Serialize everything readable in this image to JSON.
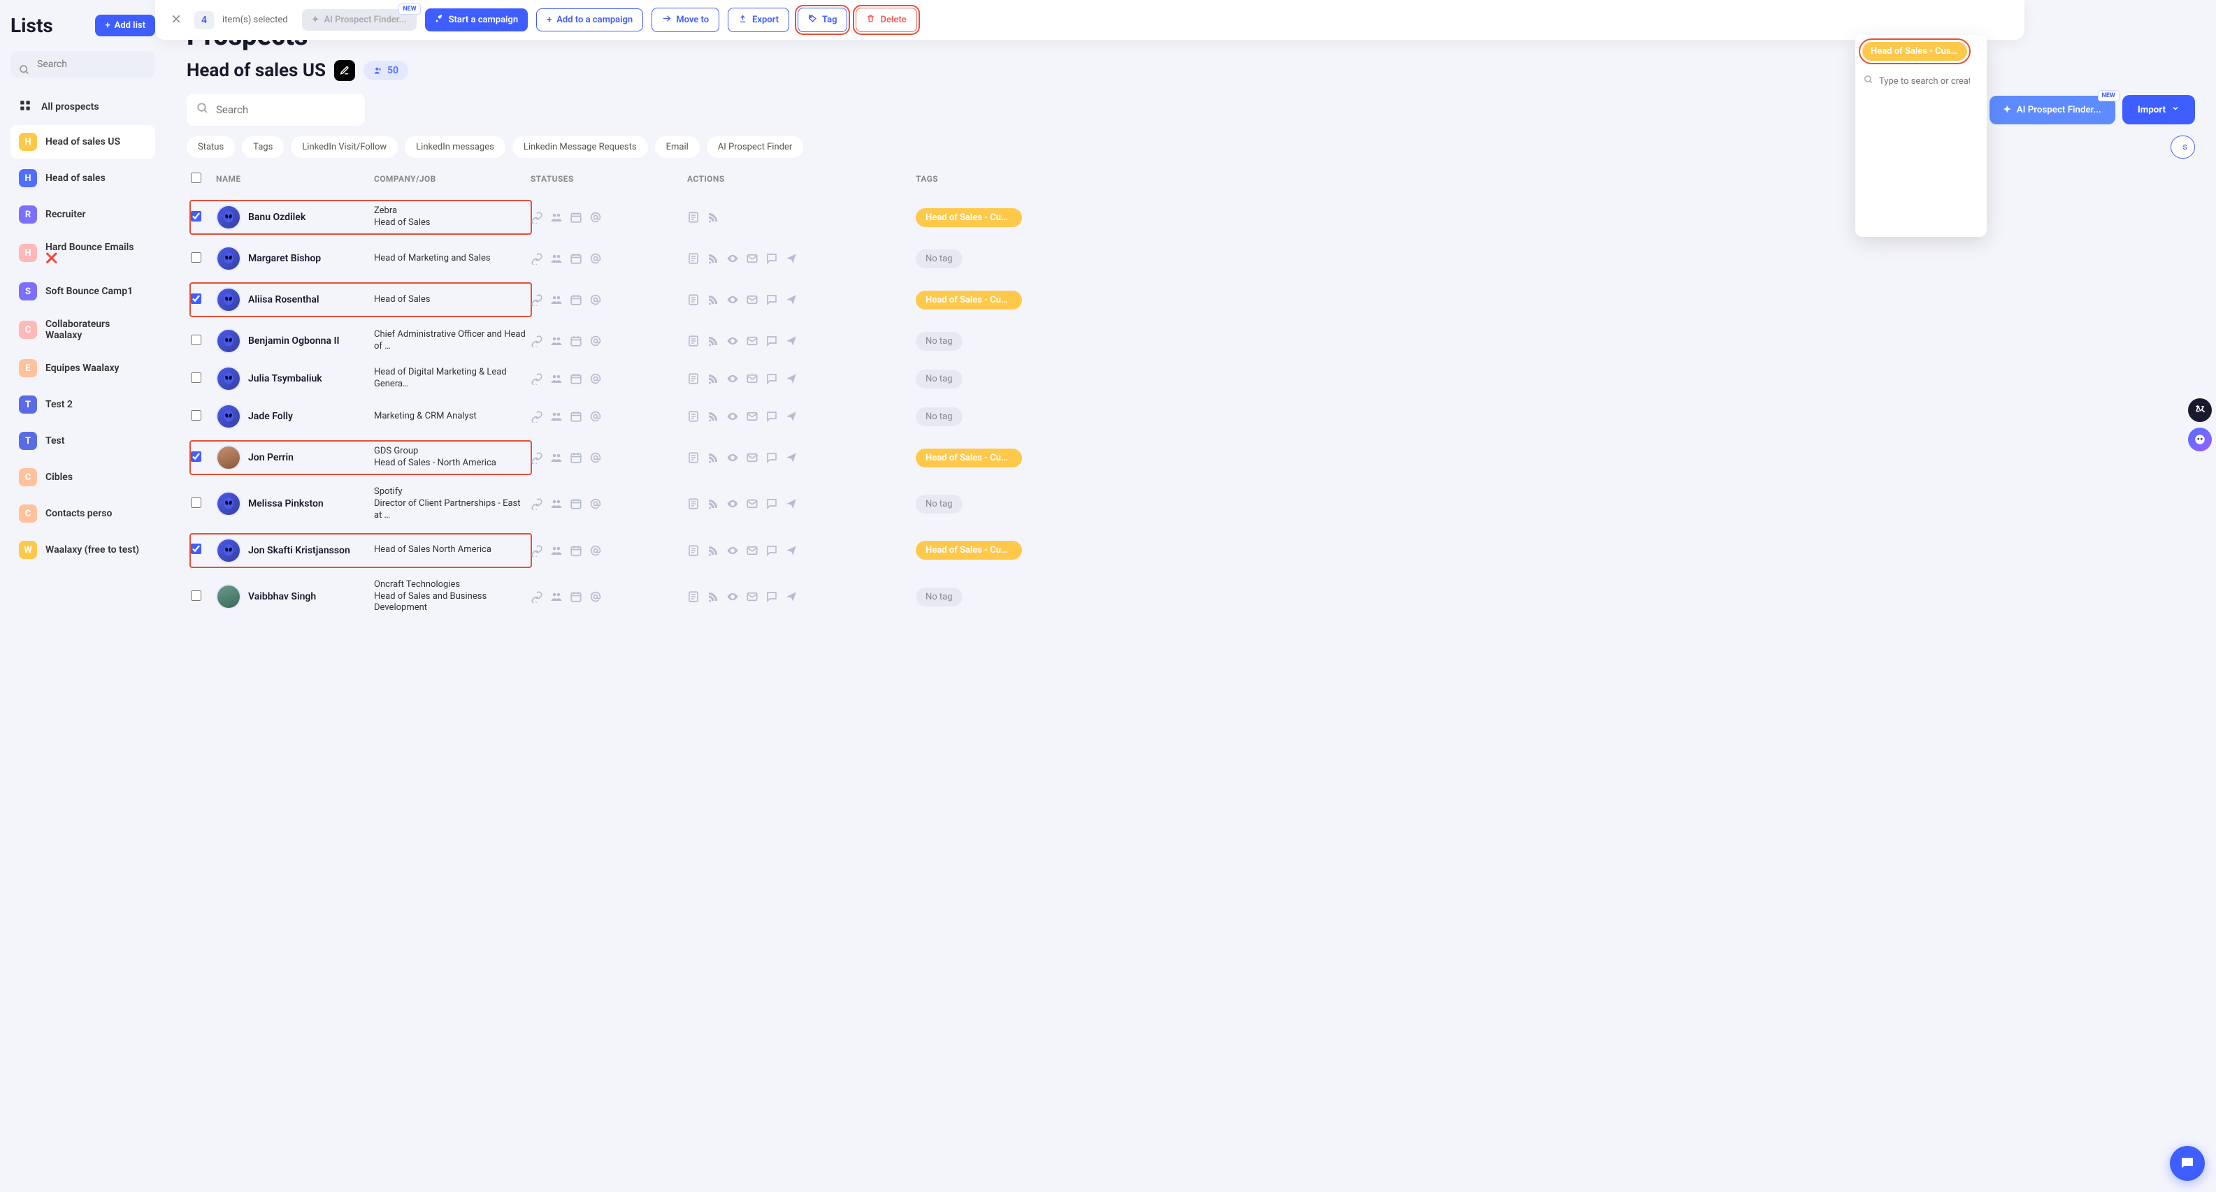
{
  "sidebar": {
    "title": "Lists",
    "add_list": "Add list",
    "search_placeholder": "Search",
    "all_prospects": "All prospects",
    "items": [
      {
        "letter": "H",
        "label": "Head of sales US",
        "cls": "ic-yellow",
        "active": true
      },
      {
        "letter": "H",
        "label": "Head of sales",
        "cls": "ic-blue"
      },
      {
        "letter": "R",
        "label": "Recruiter",
        "cls": "ic-purple"
      },
      {
        "letter": "H",
        "label": "Hard Bounce Emails ❌",
        "cls": "ic-pink"
      },
      {
        "letter": "S",
        "label": "Soft Bounce Camp1",
        "cls": "ic-purple"
      },
      {
        "letter": "C",
        "label": "Collaborateurs Waalaxy",
        "cls": "ic-pink"
      },
      {
        "letter": "E",
        "label": "Equipes Waalaxy",
        "cls": "ic-peach"
      },
      {
        "letter": "T",
        "label": "Test 2",
        "cls": "ic-teal"
      },
      {
        "letter": "T",
        "label": "Test",
        "cls": "ic-teal"
      },
      {
        "letter": "C",
        "label": "Cibles",
        "cls": "ic-peach"
      },
      {
        "letter": "C",
        "label": "Contacts perso",
        "cls": "ic-peach"
      },
      {
        "letter": "W",
        "label": "Waalaxy (free to test)",
        "cls": "ic-yellow"
      }
    ]
  },
  "topbar": {
    "count": "4",
    "selected_text": "item(s) selected",
    "ai": "AI Prospect Finder...",
    "new": "NEW",
    "start": "Start a campaign",
    "add": "Add to a campaign",
    "move": "Move to",
    "export": "Export",
    "tag": "Tag",
    "delete": "Delete"
  },
  "tag_dropdown": {
    "pill": "Head of Sales - Cust…",
    "placeholder": "Type to search or create a"
  },
  "main": {
    "title": "Prospects",
    "list_name": "Head of sales US",
    "count": "50",
    "search_placeholder": "Search",
    "ai_finder": "AI Prospect Finder...",
    "new": "NEW",
    "import": "Import",
    "filters": [
      "Status",
      "Tags",
      "LinkedIn Visit/Follow",
      "LinkedIn messages",
      "Linkedin Message Requests",
      "Email",
      "AI Prospect Finder"
    ],
    "partial_filter": "s"
  },
  "columns": {
    "name": "NAME",
    "company": "COMPANY/JOB",
    "statuses": "STATUSES",
    "actions": "ACTIONS",
    "tags": "TAGS"
  },
  "rows": [
    {
      "checked": true,
      "hl": true,
      "name": "Banu Ozdilek",
      "company": "Zebra",
      "job": "Head of Sales",
      "tag": "Head of Sales - Cust…",
      "actions_short": true
    },
    {
      "checked": false,
      "hl": false,
      "name": "Margaret Bishop",
      "company": "",
      "job": "Head of Marketing and Sales",
      "no_tag": true
    },
    {
      "checked": true,
      "hl": true,
      "name": "Aliisa Rosenthal",
      "company": "",
      "job": "Head of Sales",
      "tag": "Head of Sales - Cust…"
    },
    {
      "checked": false,
      "hl": false,
      "name": "Benjamin Ogbonna II",
      "company": "",
      "job": "Chief Administrative Officer and Head of …",
      "no_tag": true
    },
    {
      "checked": false,
      "hl": false,
      "name": "Julia Tsymbaliuk",
      "company": "",
      "job": "Head of Digital Marketing & Lead Genera…",
      "no_tag": true
    },
    {
      "checked": false,
      "hl": false,
      "name": "Jade Folly",
      "company": "",
      "job": "Marketing & CRM Analyst",
      "no_tag": true
    },
    {
      "checked": true,
      "hl": true,
      "name": "Jon Perrin",
      "company": "GDS Group",
      "job": "Head of Sales - North America",
      "tag": "Head of Sales - Cust…",
      "photo": "photo1"
    },
    {
      "checked": false,
      "hl": false,
      "name": "Melissa Pinkston",
      "company": "Spotify",
      "job": "Director of Client Partnerships - East at …",
      "no_tag": true
    },
    {
      "checked": true,
      "hl": true,
      "name": "Jon Skafti Kristjansson",
      "company": "",
      "job": "Head of Sales North America",
      "tag": "Head of Sales - Cust…"
    },
    {
      "checked": false,
      "hl": false,
      "name": "Vaibbhav Singh",
      "company": "Oncraft Technologies",
      "job": "Head of Sales and Business Development",
      "no_tag": true,
      "photo": "photo2"
    }
  ],
  "tag_label": "Head of Sales - Cust…",
  "no_tag_label": "No tag"
}
